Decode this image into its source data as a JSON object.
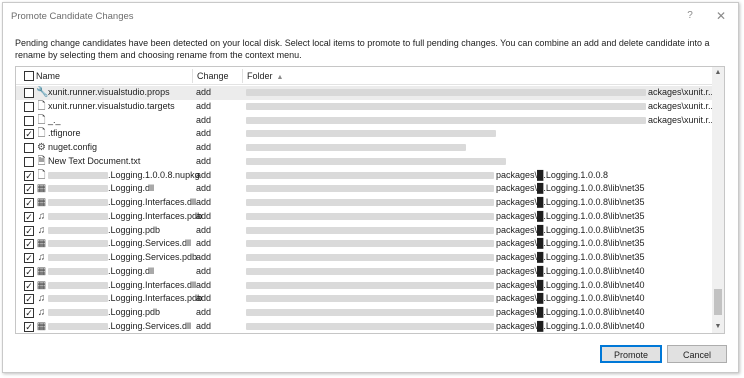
{
  "window": {
    "title": "Promote Candidate Changes",
    "help_glyph": "?",
    "close_glyph": "✕"
  },
  "description": "Pending change candidates have been detected on your local disk. Select local items to promote to full pending changes. You can combine an add and delete candidate into a rename by selecting them and choosing rename from the context menu.",
  "list": {
    "columns": {
      "name": "Name",
      "change": "Change",
      "folder": "Folder",
      "sort_indicator": "▲"
    },
    "rows": [
      {
        "name": "xunit.runner.visualstudio.props",
        "name_prefix": false,
        "change": "add",
        "folder_tail": "ackages\\xunit.r...",
        "checked": false,
        "icon": "wrench-icon",
        "selected": true
      },
      {
        "name": "xunit.runner.visualstudio.targets",
        "name_prefix": false,
        "change": "add",
        "folder_tail": "ackages\\xunit.r...",
        "checked": false,
        "icon": "file-icon",
        "selected": false
      },
      {
        "name": "_._",
        "name_prefix": false,
        "change": "add",
        "folder_tail": "ackages\\xunit.r...",
        "checked": false,
        "icon": "file-icon",
        "selected": false
      },
      {
        "name": ".tfignore",
        "name_prefix": false,
        "change": "add",
        "folder_tail": "",
        "checked": true,
        "icon": "file-icon",
        "selected": false
      },
      {
        "name": "nuget.config",
        "name_prefix": false,
        "change": "add",
        "folder_tail": "",
        "checked": false,
        "icon": "config-file-icon",
        "selected": false
      },
      {
        "name": "New Text Document.txt",
        "name_prefix": false,
        "change": "add",
        "folder_tail": "",
        "checked": false,
        "icon": "text-file-icon",
        "selected": false
      },
      {
        "name": ".Logging.1.0.0.8.nupkg",
        "name_prefix": true,
        "change": "add",
        "folder_tail": "packages\\█.Logging.1.0.0.8",
        "checked": true,
        "icon": "file-icon",
        "selected": false
      },
      {
        "name": ".Logging.dll",
        "name_prefix": true,
        "change": "add",
        "folder_tail": "packages\\█.Logging.1.0.0.8\\lib\\net35",
        "checked": true,
        "icon": "dll-icon",
        "selected": false
      },
      {
        "name": ".Logging.Interfaces.dll",
        "name_prefix": true,
        "change": "add",
        "folder_tail": "packages\\█.Logging.1.0.0.8\\lib\\net35",
        "checked": true,
        "icon": "dll-icon",
        "selected": false
      },
      {
        "name": ".Logging.Interfaces.pdb",
        "name_prefix": true,
        "change": "add",
        "folder_tail": "packages\\█.Logging.1.0.0.8\\lib\\net35",
        "checked": true,
        "icon": "pdb-icon",
        "selected": false
      },
      {
        "name": ".Logging.pdb",
        "name_prefix": true,
        "change": "add",
        "folder_tail": "packages\\█.Logging.1.0.0.8\\lib\\net35",
        "checked": true,
        "icon": "pdb-icon",
        "selected": false
      },
      {
        "name": ".Logging.Services.dll",
        "name_prefix": true,
        "change": "add",
        "folder_tail": "packages\\█.Logging.1.0.0.8\\lib\\net35",
        "checked": true,
        "icon": "dll-icon",
        "selected": false
      },
      {
        "name": ".Logging.Services.pdb",
        "name_prefix": true,
        "change": "add",
        "folder_tail": "packages\\█.Logging.1.0.0.8\\lib\\net35",
        "checked": true,
        "icon": "pdb-icon",
        "selected": false
      },
      {
        "name": ".Logging.dll",
        "name_prefix": true,
        "change": "add",
        "folder_tail": "packages\\█.Logging.1.0.0.8\\lib\\net40",
        "checked": true,
        "icon": "dll-icon",
        "selected": false
      },
      {
        "name": ".Logging.Interfaces.dll",
        "name_prefix": true,
        "change": "add",
        "folder_tail": "packages\\█.Logging.1.0.0.8\\lib\\net40",
        "checked": true,
        "icon": "dll-icon",
        "selected": false
      },
      {
        "name": ".Logging.Interfaces.pdb",
        "name_prefix": true,
        "change": "add",
        "folder_tail": "packages\\█.Logging.1.0.0.8\\lib\\net40",
        "checked": true,
        "icon": "pdb-icon",
        "selected": false
      },
      {
        "name": ".Logging.pdb",
        "name_prefix": true,
        "change": "add",
        "folder_tail": "packages\\█.Logging.1.0.0.8\\lib\\net40",
        "checked": true,
        "icon": "pdb-icon",
        "selected": false
      },
      {
        "name": ".Logging.Services.dll",
        "name_prefix": true,
        "change": "add",
        "folder_tail": "packages\\█.Logging.1.0.0.8\\lib\\net40",
        "checked": true,
        "icon": "dll-icon",
        "selected": false
      }
    ]
  },
  "scrollbar": {
    "up_glyph": "▲",
    "down_glyph": "▼"
  },
  "buttons": {
    "promote": "Promote",
    "cancel": "Cancel"
  },
  "colors": {
    "accent": "#0078d7",
    "selected_row": "#ececec",
    "redaction": "#d6d6d6"
  }
}
